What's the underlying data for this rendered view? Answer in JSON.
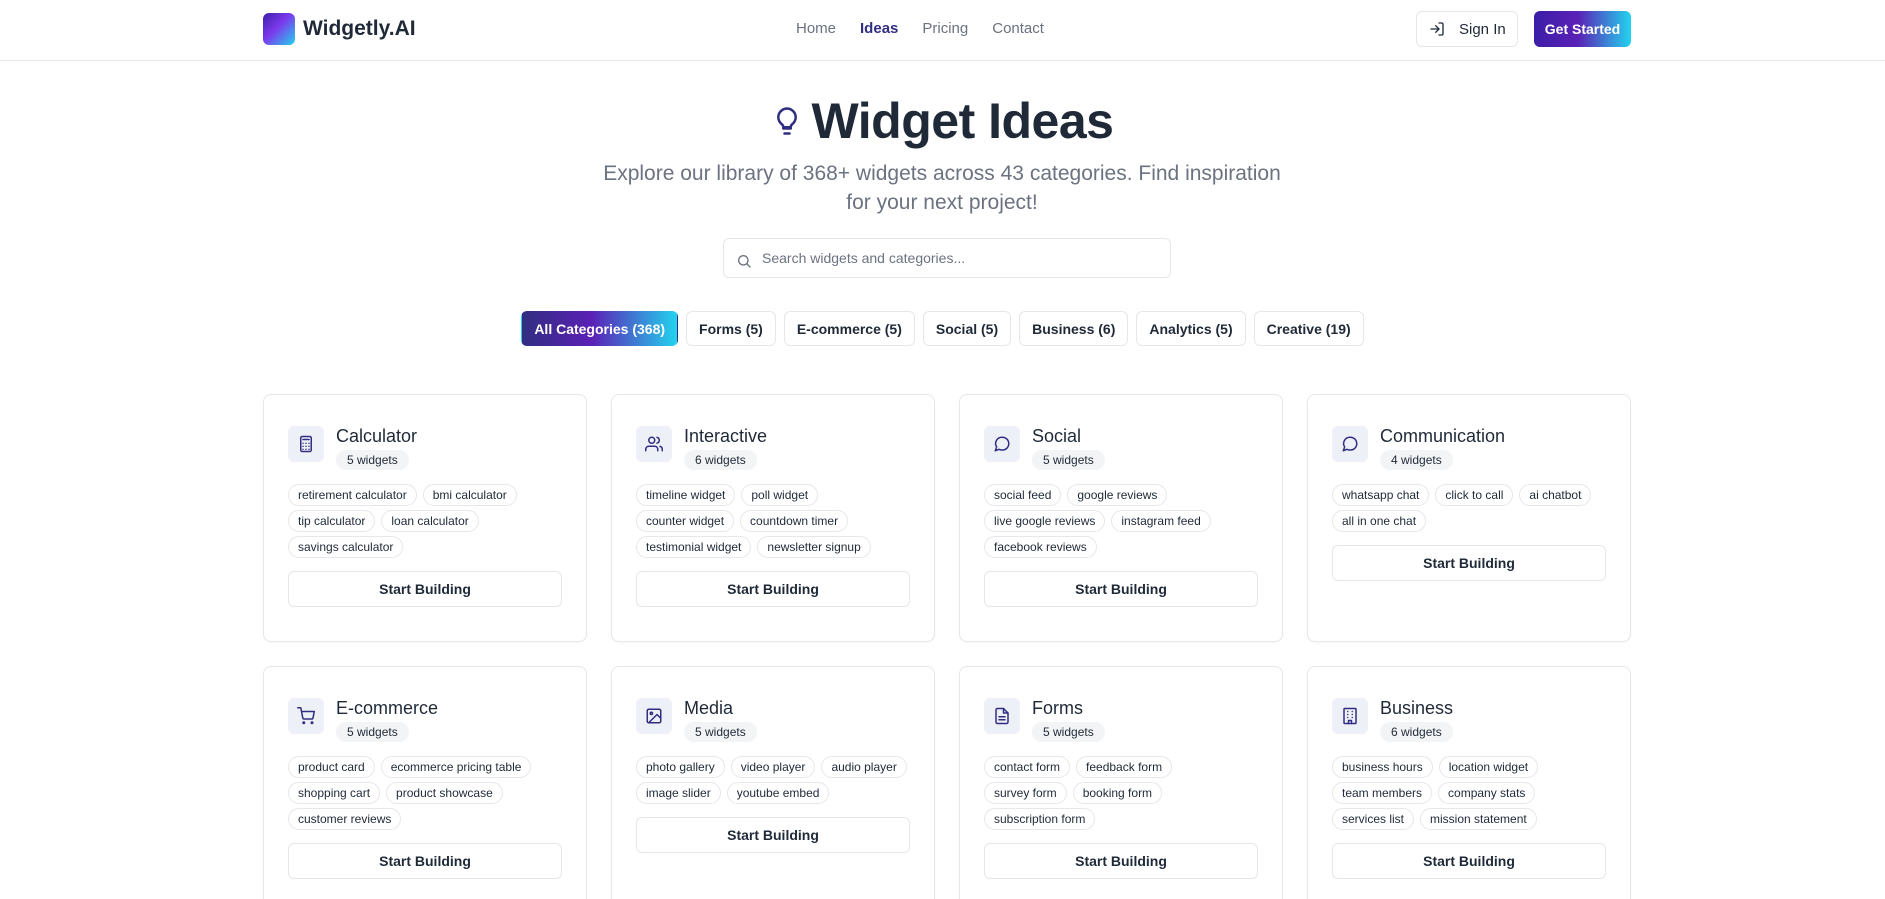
{
  "brand": {
    "name": "Widgetly.AI"
  },
  "nav": {
    "items": [
      {
        "label": "Home",
        "active": false
      },
      {
        "label": "Ideas",
        "active": true
      },
      {
        "label": "Pricing",
        "active": false
      },
      {
        "label": "Contact",
        "active": false
      }
    ]
  },
  "auth": {
    "sign_in": "Sign In",
    "get_started": "Get Started"
  },
  "hero": {
    "title": "Widget Ideas",
    "subtitle": "Explore our library of 368+ widgets across 43 categories. Find inspiration for your next project!"
  },
  "search": {
    "placeholder": "Search widgets and categories...",
    "value": ""
  },
  "filters": [
    {
      "label": "All Categories (368)",
      "active": true
    },
    {
      "label": "Forms (5)",
      "active": false
    },
    {
      "label": "E-commerce (5)",
      "active": false
    },
    {
      "label": "Social (5)",
      "active": false
    },
    {
      "label": "Business (6)",
      "active": false
    },
    {
      "label": "Analytics (5)",
      "active": false
    },
    {
      "label": "Creative (19)",
      "active": false
    }
  ],
  "cards": [
    {
      "title": "Calculator",
      "count": "5 widgets",
      "icon": "calculator-icon",
      "button": "Start Building",
      "tags": [
        "retirement calculator",
        "bmi calculator",
        "tip calculator",
        "loan calculator",
        "savings calculator"
      ]
    },
    {
      "title": "Interactive",
      "count": "6 widgets",
      "icon": "users-icon",
      "button": "Start Building",
      "tags": [
        "timeline widget",
        "poll widget",
        "counter widget",
        "countdown timer",
        "testimonial widget",
        "newsletter signup"
      ]
    },
    {
      "title": "Social",
      "count": "5 widgets",
      "icon": "chat-bubble-icon",
      "button": "Start Building",
      "tags": [
        "social feed",
        "google reviews",
        "live google reviews",
        "instagram feed",
        "facebook reviews"
      ]
    },
    {
      "title": "Communication",
      "count": "4 widgets",
      "icon": "chat-bubble-icon",
      "button": "Start Building",
      "tags": [
        "whatsapp chat",
        "click to call",
        "ai chatbot",
        "all in one chat"
      ]
    },
    {
      "title": "E-commerce",
      "count": "5 widgets",
      "icon": "shopping-cart-icon",
      "button": "Start Building",
      "tags": [
        "product card",
        "ecommerce pricing table",
        "shopping cart",
        "product showcase",
        "customer reviews"
      ]
    },
    {
      "title": "Media",
      "count": "5 widgets",
      "icon": "image-icon",
      "button": "Start Building",
      "tags": [
        "photo gallery",
        "video player",
        "audio player",
        "image slider",
        "youtube embed"
      ]
    },
    {
      "title": "Forms",
      "count": "5 widgets",
      "icon": "document-icon",
      "button": "Start Building",
      "tags": [
        "contact form",
        "feedback form",
        "survey form",
        "booking form",
        "subscription form"
      ]
    },
    {
      "title": "Business",
      "count": "6 widgets",
      "icon": "building-icon",
      "button": "Start Building",
      "tags": [
        "business hours",
        "location widget",
        "team members",
        "company stats",
        "services list",
        "mission statement"
      ]
    }
  ],
  "colors": {
    "accent": "#312e81",
    "gradient_end": "#22d3ee",
    "border": "#e5e7eb",
    "muted_text": "#6b7280"
  }
}
